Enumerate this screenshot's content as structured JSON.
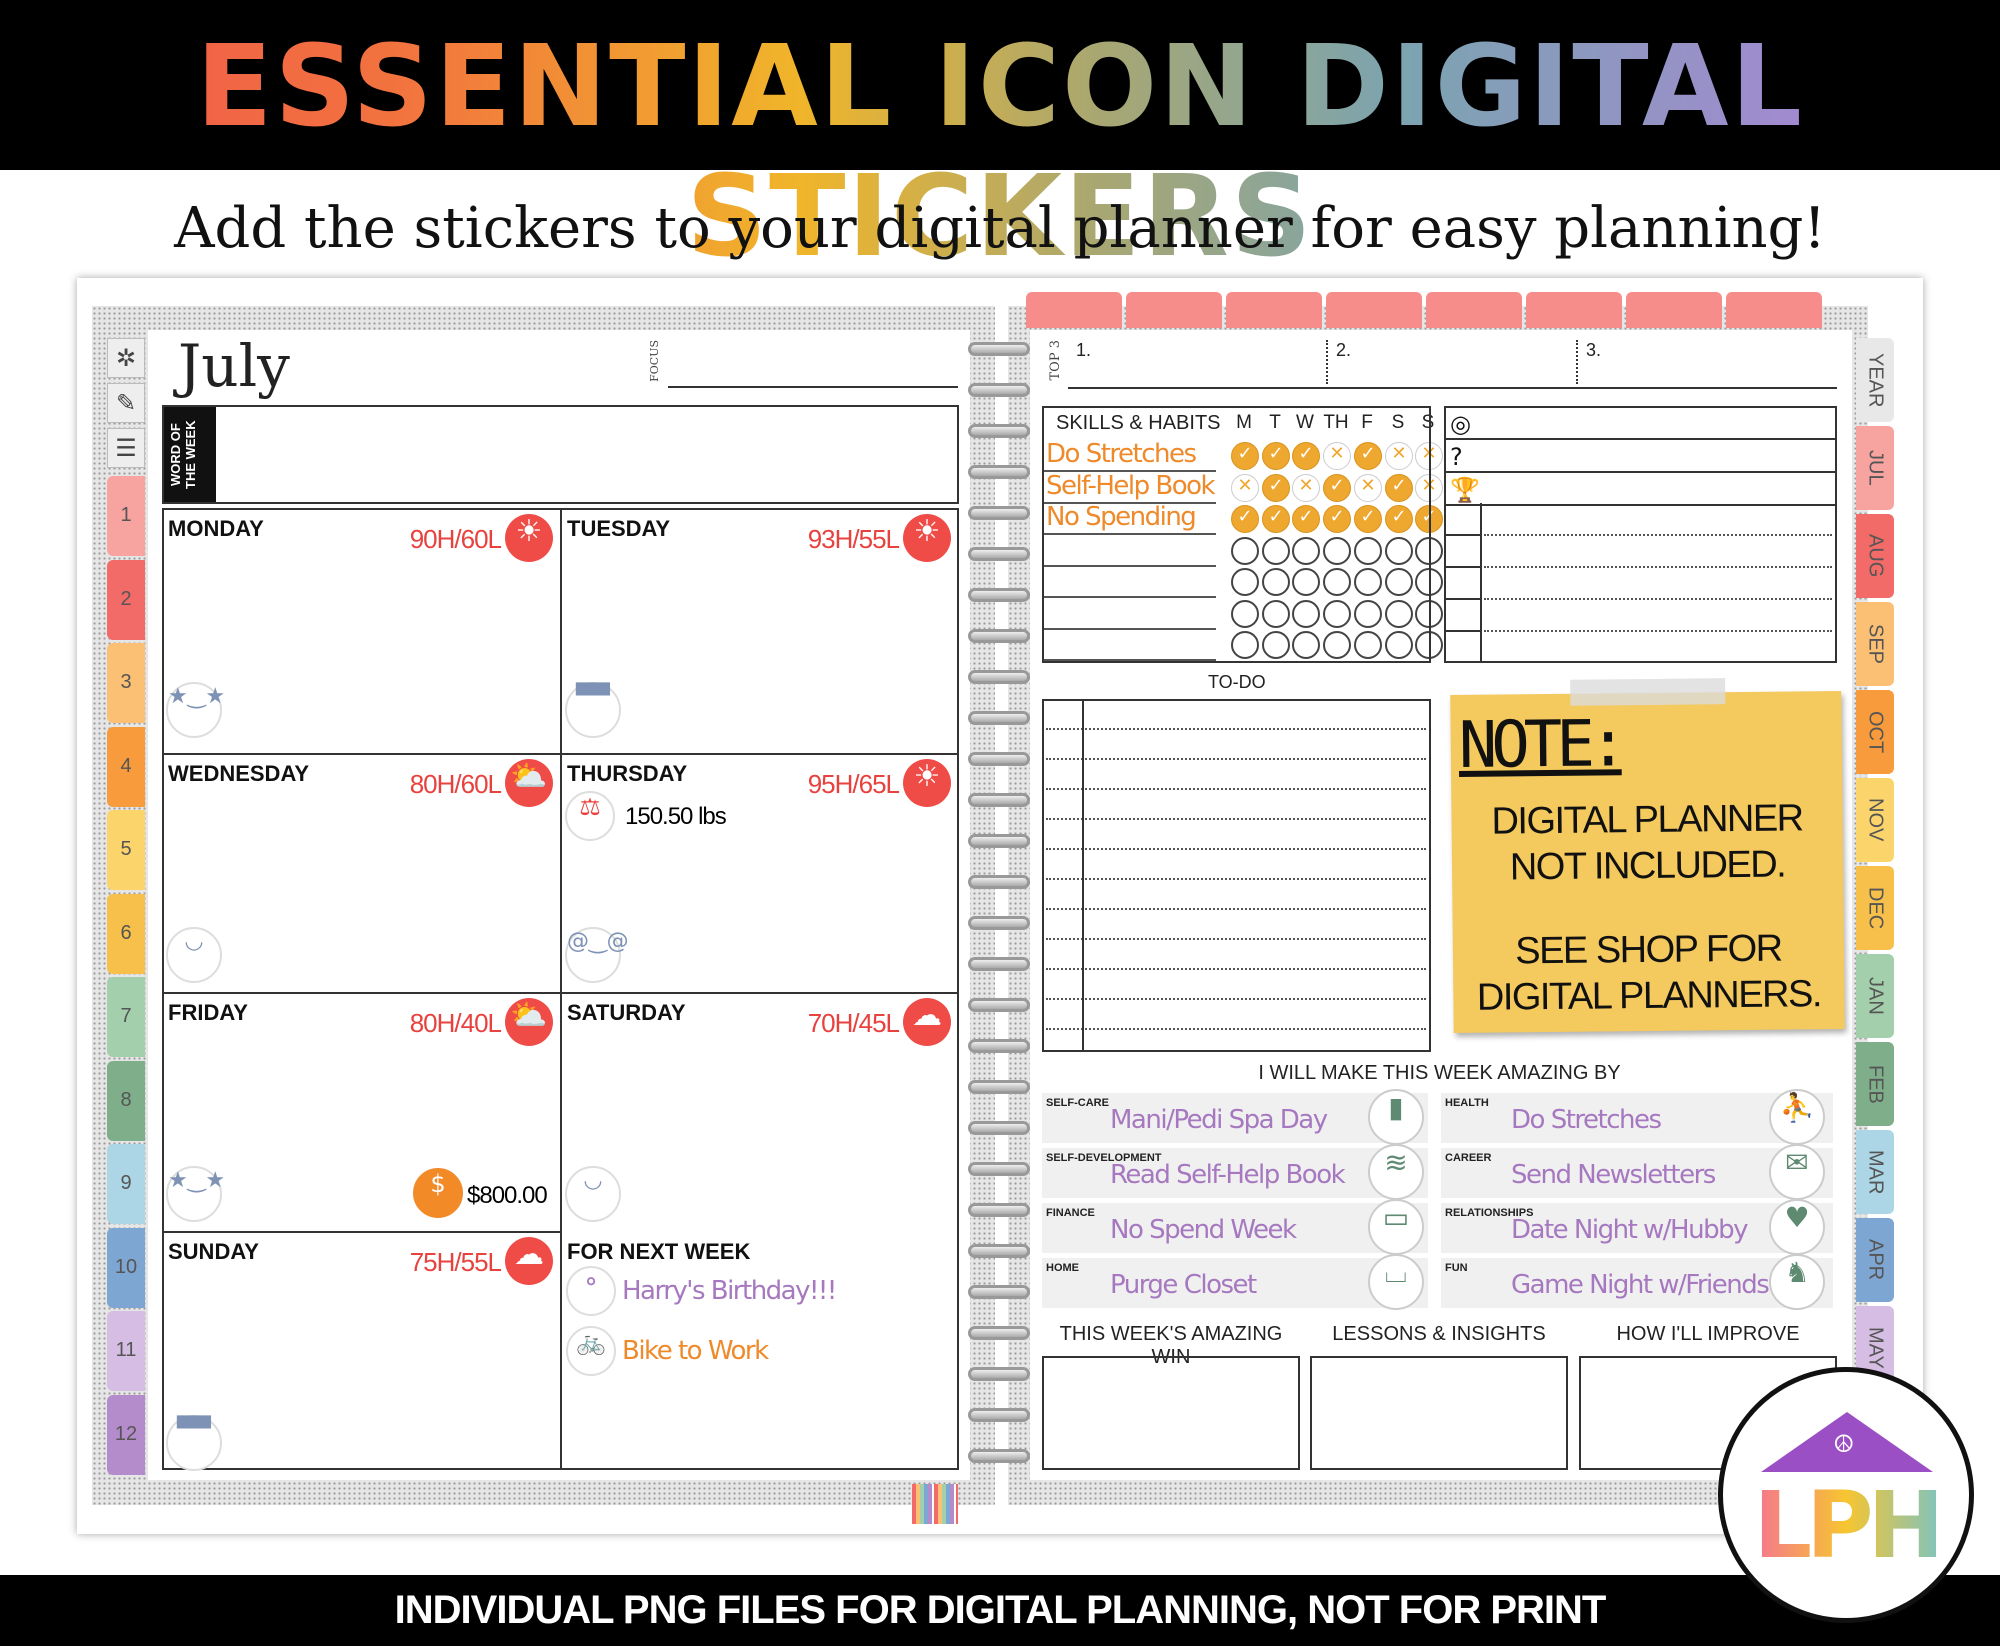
{
  "banner": {
    "title": "ESSENTIAL ICON DIGITAL STICKERS",
    "subtitle": "Add the stickers to your digital planner for easy planning!"
  },
  "left_page": {
    "month": "July",
    "focus_label": "FOCUS",
    "word_of_week_label": "WORD OF THE WEEK",
    "side_icons": [
      "compass-icon",
      "notepad-icon",
      "menu-icon"
    ],
    "month_tabs": [
      {
        "label": "1",
        "color": "#f7a3a0"
      },
      {
        "label": "2",
        "color": "#f26b68"
      },
      {
        "label": "3",
        "color": "#fbc074"
      },
      {
        "label": "4",
        "color": "#f89b3c"
      },
      {
        "label": "5",
        "color": "#fbd46b"
      },
      {
        "label": "6",
        "color": "#f7c04a"
      },
      {
        "label": "7",
        "color": "#a4cfac"
      },
      {
        "label": "8",
        "color": "#7fae8a"
      },
      {
        "label": "9",
        "color": "#acd6e6"
      },
      {
        "label": "10",
        "color": "#7ea6d2"
      },
      {
        "label": "11",
        "color": "#d6bde3"
      },
      {
        "label": "12",
        "color": "#b58ccb"
      }
    ],
    "days": [
      {
        "name": "MONDAY",
        "temp": "90H/60L",
        "weather": "sun-icon",
        "mood": "star-eyes-icon"
      },
      {
        "name": "TUESDAY",
        "temp": "93H/55L",
        "weather": "sun-icon",
        "mood": "sunglasses-icon"
      },
      {
        "name": "WEDNESDAY",
        "temp": "80H/60L",
        "weather": "partly-sunny-icon",
        "mood": "smile-icon"
      },
      {
        "name": "THURSDAY",
        "temp": "95H/65L",
        "weather": "sun-icon",
        "mood": "dizzy-icon",
        "extra": {
          "icon": "scale-icon",
          "text": "150.50 lbs"
        }
      },
      {
        "name": "FRIDAY",
        "temp": "80H/40L",
        "weather": "partly-sunny-icon",
        "mood": "star-eyes-icon",
        "extra": {
          "icon": "piggy-bank-icon",
          "text": "$800.00"
        }
      },
      {
        "name": "SATURDAY",
        "temp": "70H/45L",
        "weather": "cloud-icon",
        "mood": "smile-icon"
      },
      {
        "name": "SUNDAY",
        "temp": "75H/55L",
        "weather": "cloud-icon",
        "mood": "sunglasses-icon"
      }
    ],
    "next_week": {
      "label": "FOR NEXT WEEK",
      "items": [
        {
          "icon": "balloons-icon",
          "text": "Harry's Birthday!!!",
          "color": "#a678c0"
        },
        {
          "icon": "bicycle-icon",
          "text": "Bike to Work",
          "color": "#ef8a2b"
        }
      ]
    }
  },
  "right_page": {
    "top3": {
      "label": "TOP 3",
      "items": [
        "1.",
        "2.",
        "3."
      ]
    },
    "habits": {
      "header": "SKILLS & HABITS",
      "days": [
        "M",
        "T",
        "W",
        "TH",
        "F",
        "S",
        "S"
      ],
      "rows": [
        {
          "name": "Do Stretches",
          "marks": [
            "c",
            "c",
            "c",
            "x",
            "c",
            "x",
            "x"
          ]
        },
        {
          "name": "Self-Help Book",
          "marks": [
            "x",
            "c",
            "x",
            "c",
            "x",
            "c",
            "x"
          ]
        },
        {
          "name": "No Spending",
          "marks": [
            "c",
            "c",
            "c",
            "c",
            "c",
            "c",
            "c"
          ]
        },
        {
          "name": "",
          "marks": [
            "o",
            "o",
            "o",
            "o",
            "o",
            "o",
            "o"
          ]
        },
        {
          "name": "",
          "marks": [
            "o",
            "o",
            "o",
            "o",
            "o",
            "o",
            "o"
          ]
        },
        {
          "name": "",
          "marks": [
            "o",
            "o",
            "o",
            "o",
            "o",
            "o",
            "o"
          ]
        },
        {
          "name": "",
          "marks": [
            "o",
            "o",
            "o",
            "o",
            "o",
            "o",
            "o"
          ]
        }
      ]
    },
    "goal_icons": [
      "target-icon",
      "question-icon",
      "trophy-icon"
    ],
    "todo_label": "TO-DO",
    "note": {
      "title": "NOTE:",
      "line1": "DIGITAL PLANNER NOT INCLUDED.",
      "line2": "SEE SHOP FOR DIGITAL PLANNERS."
    },
    "amazing": {
      "label": "I WILL MAKE THIS WEEK AMAZING BY",
      "items": [
        {
          "category": "SELF-CARE",
          "text": "Mani/Pedi Spa Day",
          "icon": "nail-polish-icon"
        },
        {
          "category": "HEALTH",
          "text": "Do Stretches",
          "icon": "stretching-icon"
        },
        {
          "category": "SELF-DEVELOPMENT",
          "text": "Read Self-Help Book",
          "icon": "books-icon"
        },
        {
          "category": "CAREER",
          "text": "Send Newsletters",
          "icon": "email-icon"
        },
        {
          "category": "FINANCE",
          "text": "No Spend Week",
          "icon": "no-card-icon"
        },
        {
          "category": "RELATIONSHIPS",
          "text": "Date Night w/Hubby",
          "icon": "heart-icon"
        },
        {
          "category": "HOME",
          "text": "Purge Closet",
          "icon": "mop-bucket-icon"
        },
        {
          "category": "FUN",
          "text": "Game Night w/Friends",
          "icon": "chess-icon"
        }
      ]
    },
    "reflection": [
      "THIS WEEK'S AMAZING WIN",
      "LESSONS & INSIGHTS",
      "HOW I'LL IMPROVE"
    ],
    "side_tabs": [
      {
        "label": "YEAR",
        "color": "#e8e8e8"
      },
      {
        "label": "JUL",
        "color": "#f7a3a0"
      },
      {
        "label": "AUG",
        "color": "#f26b68"
      },
      {
        "label": "SEP",
        "color": "#fbc074"
      },
      {
        "label": "OCT",
        "color": "#f89b3c"
      },
      {
        "label": "NOV",
        "color": "#fbd46b"
      },
      {
        "label": "DEC",
        "color": "#f7c04a"
      },
      {
        "label": "JAN",
        "color": "#a4cfac"
      },
      {
        "label": "FEB",
        "color": "#7fae8a"
      },
      {
        "label": "MAR",
        "color": "#acd6e6"
      },
      {
        "label": "APR",
        "color": "#7ea6d2"
      },
      {
        "label": "MAY",
        "color": "#d6bde3"
      }
    ]
  },
  "logo": {
    "text": "LPH"
  },
  "footer": {
    "text": "INDIVIDUAL PNG FILES FOR DIGITAL PLANNING, NOT FOR PRINT"
  }
}
